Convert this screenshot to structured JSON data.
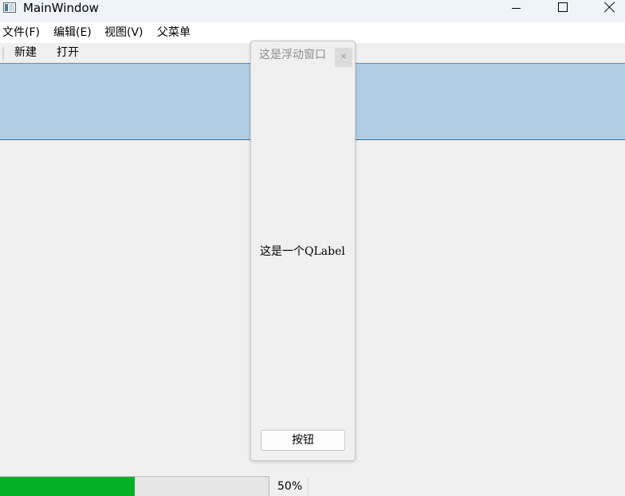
{
  "window": {
    "title": "MainWindow"
  },
  "menubar": {
    "items": [
      "文件(F)",
      "编辑(E)",
      "视图(V)",
      "父菜单"
    ]
  },
  "toolbar": {
    "buttons": [
      "新建",
      "打开"
    ]
  },
  "dock": {
    "title": "这是浮动窗口",
    "close_glyph": "×",
    "label": "这是一个QLabel",
    "button": "按钮"
  },
  "status": {
    "progress_text": "50%",
    "progress_value": 0.5,
    "progress_color": "#06b025"
  },
  "colors": {
    "panel": "#aecde5"
  }
}
